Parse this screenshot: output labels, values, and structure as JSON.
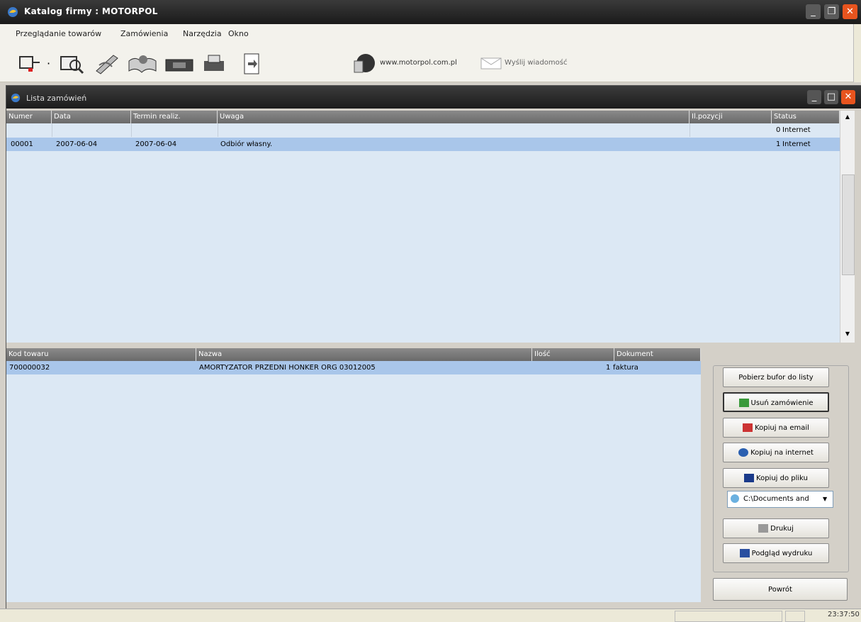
{
  "app": {
    "title": "Katalog firmy : MOTORPOL"
  },
  "menu": [
    "Przeglądanie towarów",
    "Zamówienia",
    "Narzędzia",
    "Okno"
  ],
  "toolbar": {
    "website": "www.motorpol.com.pl",
    "send_message": "Wyślij wiadomość"
  },
  "child": {
    "title": "Lista zamówień"
  },
  "orders": {
    "columns": [
      "Numer",
      "Data",
      "Termin realiz.",
      "Uwaga",
      "Il.pozycji",
      "Status"
    ],
    "rows": [
      {
        "numer": "",
        "data": "",
        "termin": "",
        "uwaga": "",
        "ilosc": "0",
        "status": "Internet"
      },
      {
        "numer": "00001",
        "data": "2007-06-04",
        "termin": "2007-06-04",
        "uwaga": "Odbiór własny.",
        "ilosc": "1",
        "status": "Internet"
      }
    ]
  },
  "items": {
    "columns": [
      "Kod towaru",
      "Nazwa",
      "Ilość",
      "Dokument"
    ],
    "rows": [
      {
        "kod": "700000032",
        "nazwa": "AMORTYZATOR PRZEDNI HONKER ORG 03012005",
        "ilosc": "1",
        "dokument": "faktura"
      }
    ]
  },
  "buttons": {
    "fetch_buffer": "Pobierz bufor do listy",
    "delete_order": "Usuń zamówienie",
    "copy_email": "Kopiuj na email",
    "copy_internet": "Kopiuj na internet",
    "copy_file": "Kopiuj do pliku",
    "path_value": "C:\\Documents and",
    "print": "Drukuj",
    "print_preview": "Podgląd wydruku",
    "back": "Powrót"
  },
  "status": {
    "clock": "23:37:50"
  },
  "colors": {
    "accent": "#e8541e",
    "selection": "#a9c6ea",
    "grid_bg": "#dce8f4"
  }
}
